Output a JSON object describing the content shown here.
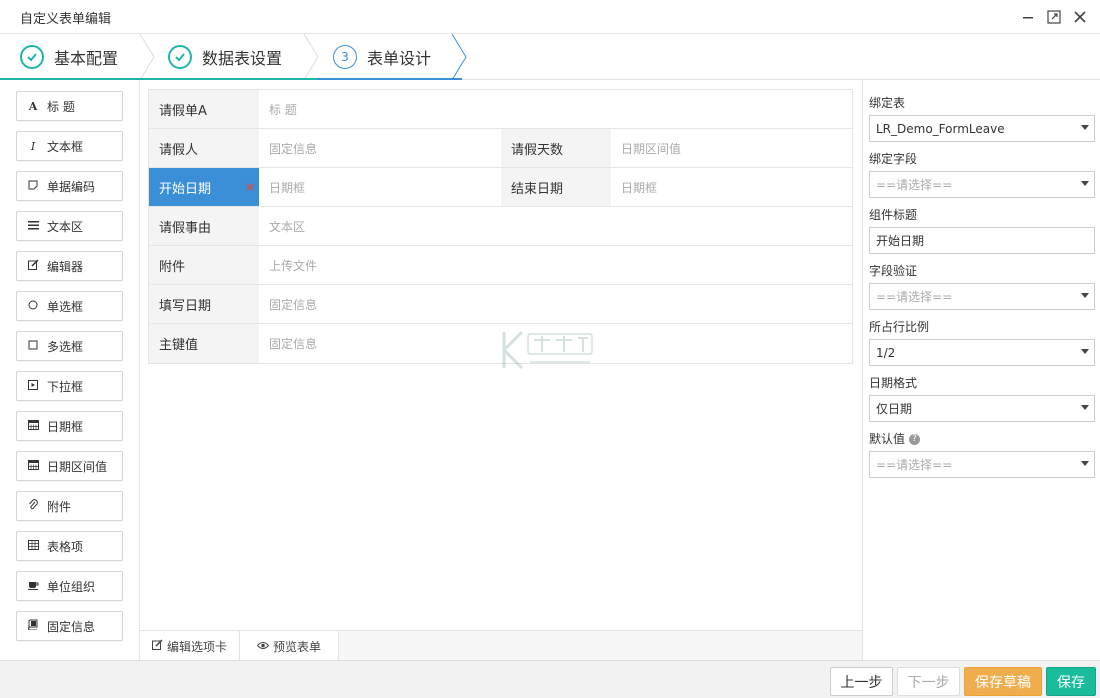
{
  "window": {
    "title": "自定义表单编辑",
    "buttons": [
      "minimize",
      "maximize",
      "close"
    ]
  },
  "steps": [
    {
      "label": "基本配置",
      "state": "done"
    },
    {
      "label": "数据表设置",
      "state": "done"
    },
    {
      "number": "3",
      "label": "表单设计",
      "state": "active"
    }
  ],
  "palette": [
    {
      "label": "标 题",
      "icon": "font-icon"
    },
    {
      "label": "文本框",
      "icon": "italic-icon"
    },
    {
      "label": "单据编码",
      "icon": "sticky-note-icon"
    },
    {
      "label": "文本区",
      "icon": "list-icon"
    },
    {
      "label": "编辑器",
      "icon": "edit-icon"
    },
    {
      "label": "单选框",
      "icon": "circle-icon"
    },
    {
      "label": "多选框",
      "icon": "square-icon"
    },
    {
      "label": "下拉框",
      "icon": "caret-square-icon"
    },
    {
      "label": "日期框",
      "icon": "calendar-icon"
    },
    {
      "label": "日期区间值",
      "icon": "calendar-range-icon"
    },
    {
      "label": "附件",
      "icon": "paperclip-icon"
    },
    {
      "label": "表格项",
      "icon": "table-icon"
    },
    {
      "label": "单位组织",
      "icon": "coffee-icon"
    },
    {
      "label": "固定信息",
      "icon": "book-icon"
    }
  ],
  "form": {
    "rows": [
      {
        "label": "请假单A",
        "value": "标 题"
      },
      {
        "label": "请假人",
        "value": "固定信息",
        "label2": "请假天数",
        "value2": "日期区间值"
      },
      {
        "label": "开始日期",
        "value": "日期框",
        "label2": "结束日期",
        "value2": "日期框",
        "active": true
      },
      {
        "label": "请假事由",
        "value": "文本区"
      },
      {
        "label": "附件",
        "value": "上传文件"
      },
      {
        "label": "填写日期",
        "value": "固定信息"
      },
      {
        "label": "主键值",
        "value": "固定信息"
      }
    ],
    "delete_mark": "×"
  },
  "canvas_tabs": [
    {
      "label": "编辑选项卡",
      "icon": "edit-icon"
    },
    {
      "label": "预览表单",
      "icon": "eye-icon"
    }
  ],
  "props": {
    "bind_table": {
      "label": "绑定表",
      "value": "LR_Demo_FormLeave"
    },
    "bind_field": {
      "label": "绑定字段",
      "value": "==请选择=="
    },
    "component_title": {
      "label": "组件标题",
      "value": "开始日期"
    },
    "field_validation": {
      "label": "字段验证",
      "value": "==请选择=="
    },
    "row_ratio": {
      "label": "所占行比例",
      "value": "1/2"
    },
    "date_format": {
      "label": "日期格式",
      "value": "仅日期"
    },
    "default_value": {
      "label": "默认值",
      "value": "==请选择=="
    }
  },
  "footer": {
    "prev": "上一步",
    "next": "下一步",
    "draft": "保存草稿",
    "save": "保存"
  },
  "colors": {
    "accent_blue": "#3a8fd6",
    "done_teal": "#1fb5ac",
    "draft_orange": "#f0ad4e",
    "save_green": "#1abc9c"
  }
}
